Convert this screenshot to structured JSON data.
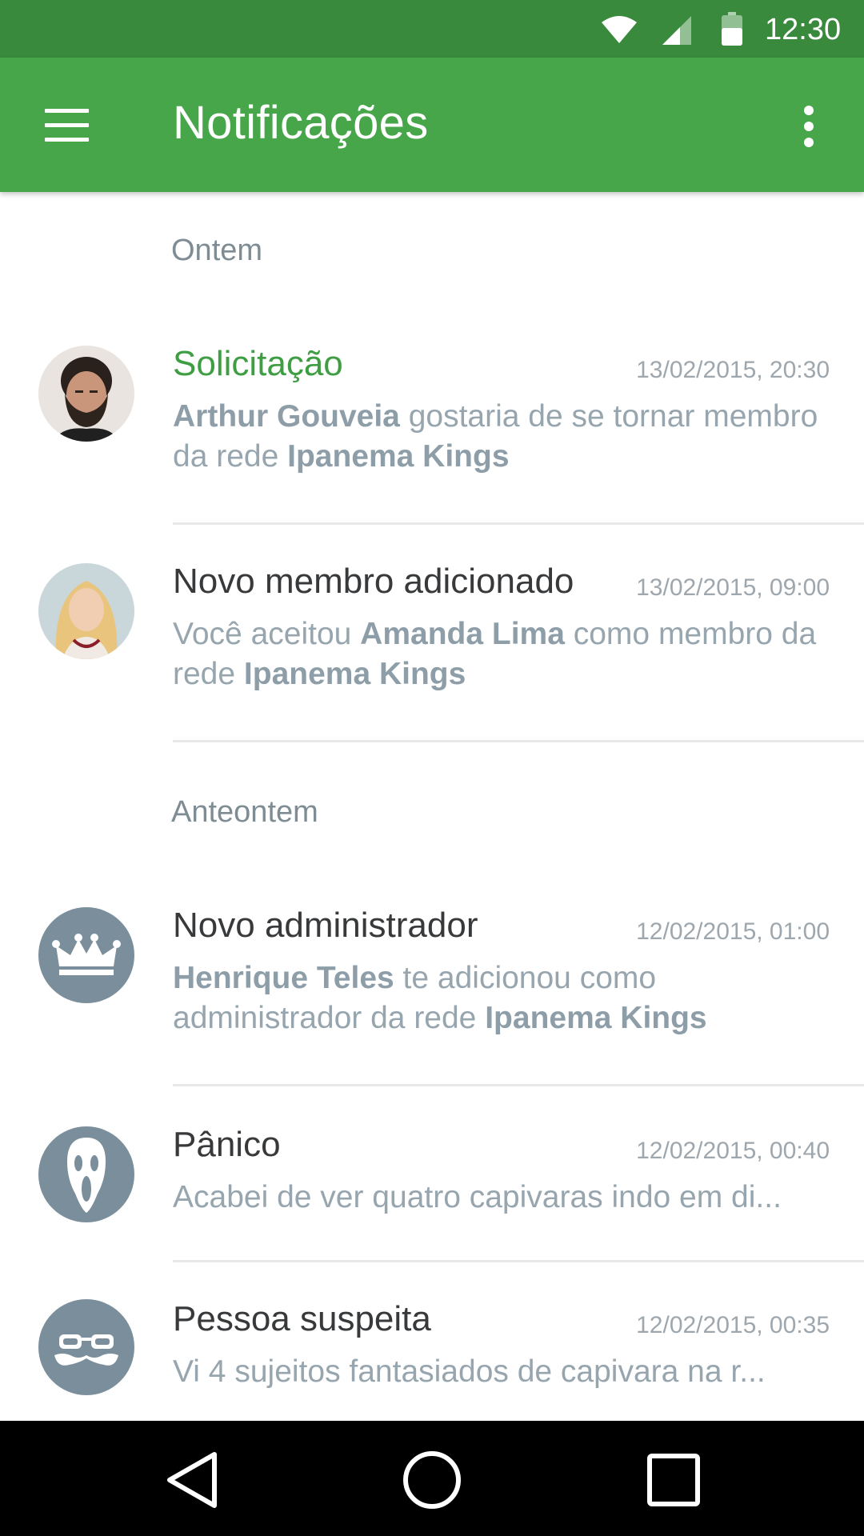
{
  "status_bar": {
    "time": "12:30"
  },
  "app_bar": {
    "title": "Notificações"
  },
  "sections": [
    {
      "label": "Ontem"
    },
    {
      "label": "Anteontem"
    }
  ],
  "notifications": [
    {
      "title": "Solicitação",
      "time": "13/02/2015, 20:30",
      "body": [
        {
          "text": "Arthur Gouveia",
          "bold": true
        },
        {
          "text": " gostaria de se tornar membro da rede ",
          "bold": false
        },
        {
          "text": "Ipanema Kings",
          "bold": true
        }
      ]
    },
    {
      "title": "Novo membro adicionado",
      "time": "13/02/2015, 09:00",
      "body": [
        {
          "text": "Você aceitou ",
          "bold": false
        },
        {
          "text": "Amanda Lima",
          "bold": true
        },
        {
          "text": " como membro da rede ",
          "bold": false
        },
        {
          "text": "Ipanema Kings",
          "bold": true
        }
      ]
    },
    {
      "title": "Novo administrador",
      "time": "12/02/2015, 01:00",
      "body": [
        {
          "text": "Henrique Teles",
          "bold": true
        },
        {
          "text": " te adicionou como administrador da rede ",
          "bold": false
        },
        {
          "text": "Ipanema Kings",
          "bold": true
        }
      ]
    },
    {
      "title": "Pânico",
      "time": "12/02/2015, 00:40",
      "body": [
        {
          "text": "Acabei de ver quatro capivaras indo em di...",
          "bold": false
        }
      ]
    },
    {
      "title": "Pessoa suspeita",
      "time": "12/02/2015, 00:35",
      "body": [
        {
          "text": "Vi 4 sujeitos fantasiados de capivara na r...",
          "bold": false
        }
      ]
    }
  ],
  "colors": {
    "status_bar": "#398a3c",
    "app_bar": "#47a54a",
    "accent_title": "#3f9d43",
    "icon_avatar": "#7b8e9b"
  },
  "icons": {
    "status": [
      "wifi-icon",
      "signal-icon",
      "battery-icon"
    ],
    "app_bar": [
      "menu-icon",
      "more-vert-icon"
    ],
    "avatars": [
      "user-photo",
      "user-photo",
      "crown-icon",
      "scream-mask-icon",
      "disguise-glasses-mustache-icon"
    ],
    "nav": [
      "back-icon",
      "home-icon",
      "recents-icon"
    ]
  }
}
